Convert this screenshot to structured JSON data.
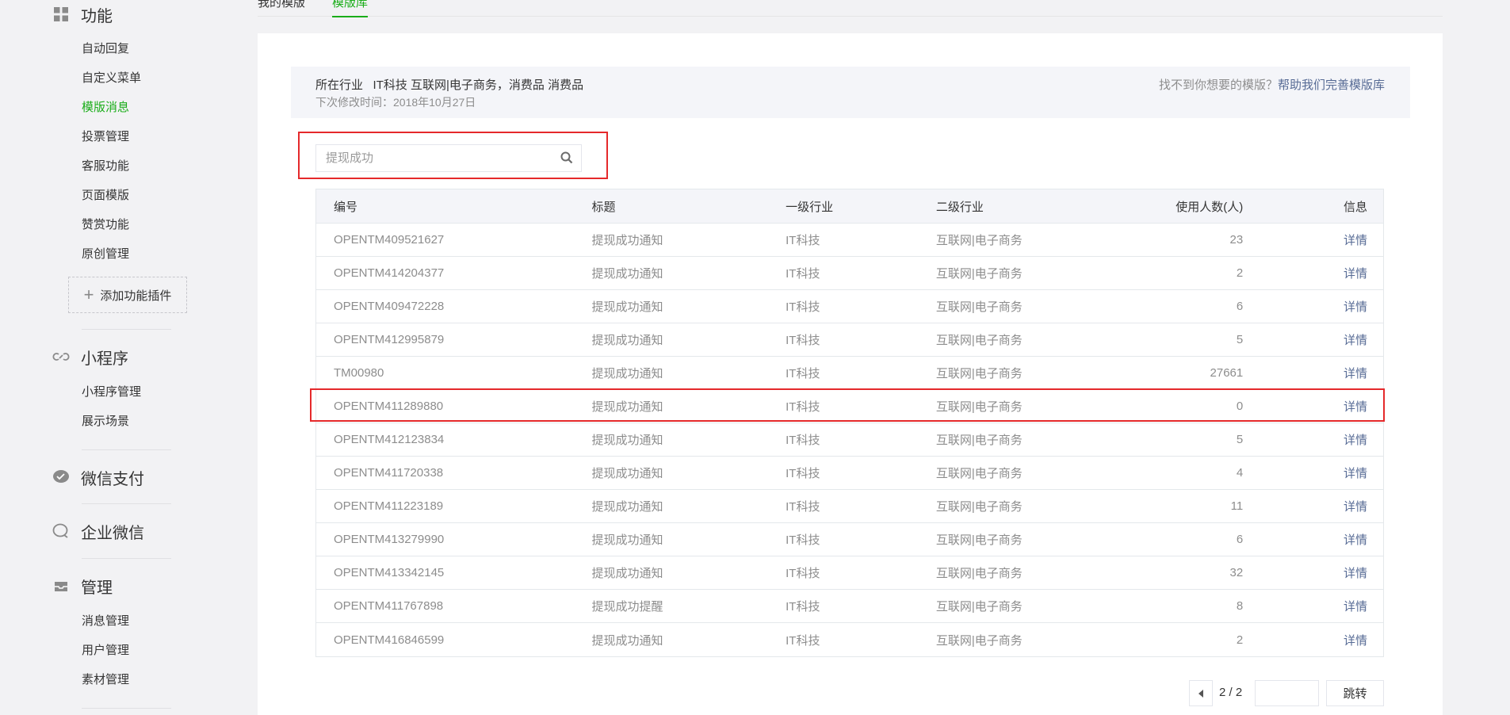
{
  "sidebar": {
    "feature": {
      "title": "功能",
      "icon": "grid-icon",
      "items": [
        "自动回复",
        "自定义菜单",
        "模版消息",
        "投票管理",
        "客服功能",
        "页面模版",
        "赞赏功能",
        "原创管理"
      ],
      "active_index": 2,
      "add_plugin_label": "添加功能插件"
    },
    "miniprogram": {
      "title": "小程序",
      "icon": "link-icon",
      "items": [
        "小程序管理",
        "展示场景"
      ]
    },
    "wechatpay": {
      "title": "微信支付",
      "icon": "chat-bubble-icon"
    },
    "wework": {
      "title": "企业微信",
      "icon": "chat-icon"
    },
    "manage": {
      "title": "管理",
      "icon": "inbox-icon",
      "items": [
        "消息管理",
        "用户管理",
        "素材管理"
      ]
    }
  },
  "tabs": [
    "我的模版",
    "模版库"
  ],
  "info": {
    "industry_label": "所在行业",
    "industry_value": "IT科技 互联网|电子商务，消费品 消费品",
    "next_edit_label": "下次修改时间：",
    "next_edit_value": "2018年10月27日",
    "help_prefix": "找不到你想要的模版？",
    "help_link": "帮助我们完善模版库"
  },
  "search": {
    "placeholder": "提现成功"
  },
  "table": {
    "headers": [
      "编号",
      "标题",
      "一级行业",
      "二级行业",
      "使用人数(人)",
      "信息"
    ],
    "detail_label": "详情",
    "rows": [
      [
        "OPENTM409521627",
        "提现成功通知",
        "IT科技",
        "互联网|电子商务",
        "23"
      ],
      [
        "OPENTM414204377",
        "提现成功通知",
        "IT科技",
        "互联网|电子商务",
        "2"
      ],
      [
        "OPENTM409472228",
        "提现成功通知",
        "IT科技",
        "互联网|电子商务",
        "6"
      ],
      [
        "OPENTM412995879",
        "提现成功通知",
        "IT科技",
        "互联网|电子商务",
        "5"
      ],
      [
        "TM00980",
        "提现成功通知",
        "IT科技",
        "互联网|电子商务",
        "27661"
      ],
      [
        "OPENTM411289880",
        "提现成功通知",
        "IT科技",
        "互联网|电子商务",
        "0"
      ],
      [
        "OPENTM412123834",
        "提现成功通知",
        "IT科技",
        "互联网|电子商务",
        "5"
      ],
      [
        "OPENTM411720338",
        "提现成功通知",
        "IT科技",
        "互联网|电子商务",
        "4"
      ],
      [
        "OPENTM411223189",
        "提现成功通知",
        "IT科技",
        "互联网|电子商务",
        "11"
      ],
      [
        "OPENTM413279990",
        "提现成功通知",
        "IT科技",
        "互联网|电子商务",
        "6"
      ],
      [
        "OPENTM413342145",
        "提现成功通知",
        "IT科技",
        "互联网|电子商务",
        "32"
      ],
      [
        "OPENTM411767898",
        "提现成功提醒",
        "IT科技",
        "互联网|电子商务",
        "8"
      ],
      [
        "OPENTM416846599",
        "提现成功通知",
        "IT科技",
        "互联网|电子商务",
        "2"
      ]
    ]
  },
  "pager": {
    "count": "2 / 2",
    "go_label": "跳转"
  },
  "colors": {
    "accent": "#1aad19",
    "link": "#576b95",
    "highlight": "#e5292b"
  }
}
